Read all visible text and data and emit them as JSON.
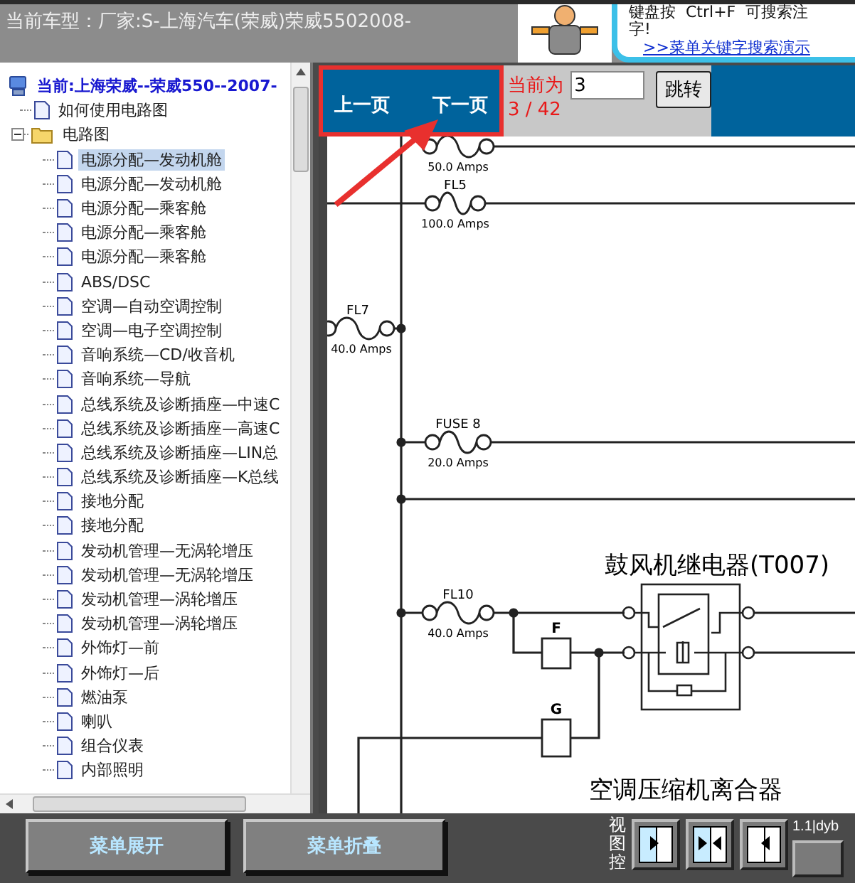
{
  "header": {
    "title": "当前车型：厂家:S-上海汽车(荣威)荣威5502008-",
    "tip_lines": [
      "键盘按  Ctrl+F  可搜索注",
      "字!"
    ],
    "tip_link": ">>菜单关键字搜索演示"
  },
  "tree": {
    "root": {
      "label": "当前:上海荣威--荣威550--2007-",
      "children": [
        {
          "kind": "doc",
          "label": "如何使用电路图"
        },
        {
          "kind": "folder",
          "label": "电路图",
          "expanded": true,
          "children": [
            {
              "label": "电源分配—发动机舱",
              "selected": true
            },
            {
              "label": "电源分配—发动机舱",
              "selected": false
            },
            {
              "label": "电源分配—乘客舱",
              "selected": false
            },
            {
              "label": "电源分配—乘客舱",
              "selected": false
            },
            {
              "label": "电源分配—乘客舱",
              "selected": false
            },
            {
              "label": "ABS/DSC",
              "selected": false
            },
            {
              "label": "空调—自动空调控制",
              "selected": false
            },
            {
              "label": "空调—电子空调控制",
              "selected": false
            },
            {
              "label": "音响系统—CD/收音机",
              "selected": false
            },
            {
              "label": "音响系统—导航",
              "selected": false
            },
            {
              "label": "总线系统及诊断插座—中速C",
              "selected": false
            },
            {
              "label": "总线系统及诊断插座—高速C",
              "selected": false
            },
            {
              "label": "总线系统及诊断插座—LIN总",
              "selected": false
            },
            {
              "label": "总线系统及诊断插座—K总线",
              "selected": false
            },
            {
              "label": "接地分配",
              "selected": false
            },
            {
              "label": "接地分配",
              "selected": false
            },
            {
              "label": "发动机管理—无涡轮增压",
              "selected": false
            },
            {
              "label": "发动机管理—无涡轮增压",
              "selected": false
            },
            {
              "label": "发动机管理—涡轮增压",
              "selected": false
            },
            {
              "label": "发动机管理—涡轮增压",
              "selected": false
            },
            {
              "label": "外饰灯—前",
              "selected": false
            },
            {
              "label": "外饰灯—后",
              "selected": false
            },
            {
              "label": "燃油泵",
              "selected": false
            },
            {
              "label": "喇叭",
              "selected": false
            },
            {
              "label": "组合仪表",
              "selected": false
            },
            {
              "label": "内部照明",
              "selected": false
            }
          ]
        }
      ]
    }
  },
  "pager": {
    "prev": "上一页",
    "next": "下一页",
    "current_label": "当前为",
    "current_value": "3",
    "go": "跳转",
    "page_count": "3 / 42"
  },
  "diagram": {
    "fuses": [
      {
        "rating": "50.0 Amps"
      },
      {
        "name": "FL5",
        "rating": "100.0 Amps"
      },
      {
        "name": "FL7",
        "rating": "40.0 Amps"
      },
      {
        "name": "FUSE 8",
        "rating": "20.0 Amps"
      },
      {
        "name": "FL10",
        "rating": "40.0 Amps"
      }
    ],
    "connectors": [
      "F",
      "G"
    ],
    "relay_title": "鼓风机继电器(T007)",
    "clutch_title": "空调压缩机离合器"
  },
  "footer": {
    "buttons": [
      "菜单展开",
      "菜单折叠"
    ],
    "view_label": "视图控",
    "view_buttons": [
      {
        "kind": "right"
      },
      {
        "kind": "both"
      },
      {
        "kind": "left"
      }
    ],
    "version": "1.1|dyb"
  }
}
